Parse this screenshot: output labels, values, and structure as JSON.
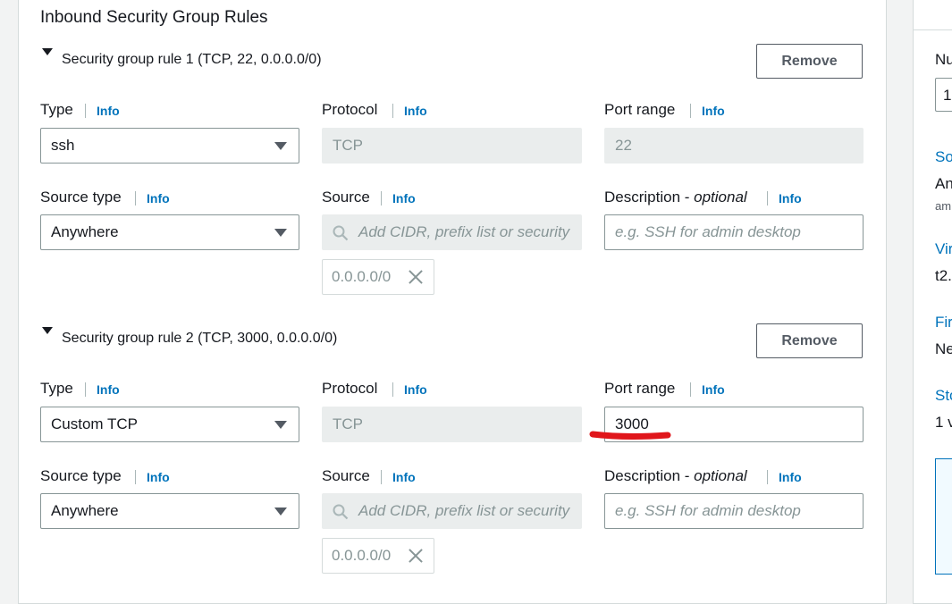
{
  "section_title": "Inbound Security Group Rules",
  "info_label": "Info",
  "remove_label": "Remove",
  "labels": {
    "type": "Type",
    "protocol": "Protocol",
    "port_range": "Port range",
    "source_type": "Source type",
    "source": "Source",
    "description": "Description - ",
    "optional": "optional"
  },
  "rules": [
    {
      "header": "Security group rule 1 (TCP, 22, 0.0.0.0/0)",
      "type": "ssh",
      "protocol": "TCP",
      "port_range": "22",
      "source_type": "Anywhere",
      "source_placeholder": "Add CIDR, prefix list or security",
      "source_token": "0.0.0.0/0",
      "description_placeholder": "e.g. SSH for admin desktop"
    },
    {
      "header": "Security group rule 2 (TCP, 3000, 0.0.0.0/0)",
      "type": "Custom TCP",
      "protocol": "TCP",
      "port_range": "3000",
      "source_type": "Anywhere",
      "source_placeholder": "Add CIDR, prefix list or security",
      "source_token": "0.0.0.0/0",
      "description_placeholder": "e.g. SSH for admin desktop"
    }
  ],
  "summary_panel": {
    "number_label": "Nu",
    "number_value": "1",
    "software_link": "So",
    "software_value": "An",
    "software_sub": "am",
    "virtual_link": "Vir",
    "virtual_value": "t2.",
    "firewall_link": "Fir",
    "firewall_value": "Ne",
    "storage_link": "Sto",
    "storage_value": "1 v"
  },
  "colors": {
    "link": "#0073bb",
    "annotation": "#e0161b",
    "disabled_bg": "#eaeded"
  }
}
